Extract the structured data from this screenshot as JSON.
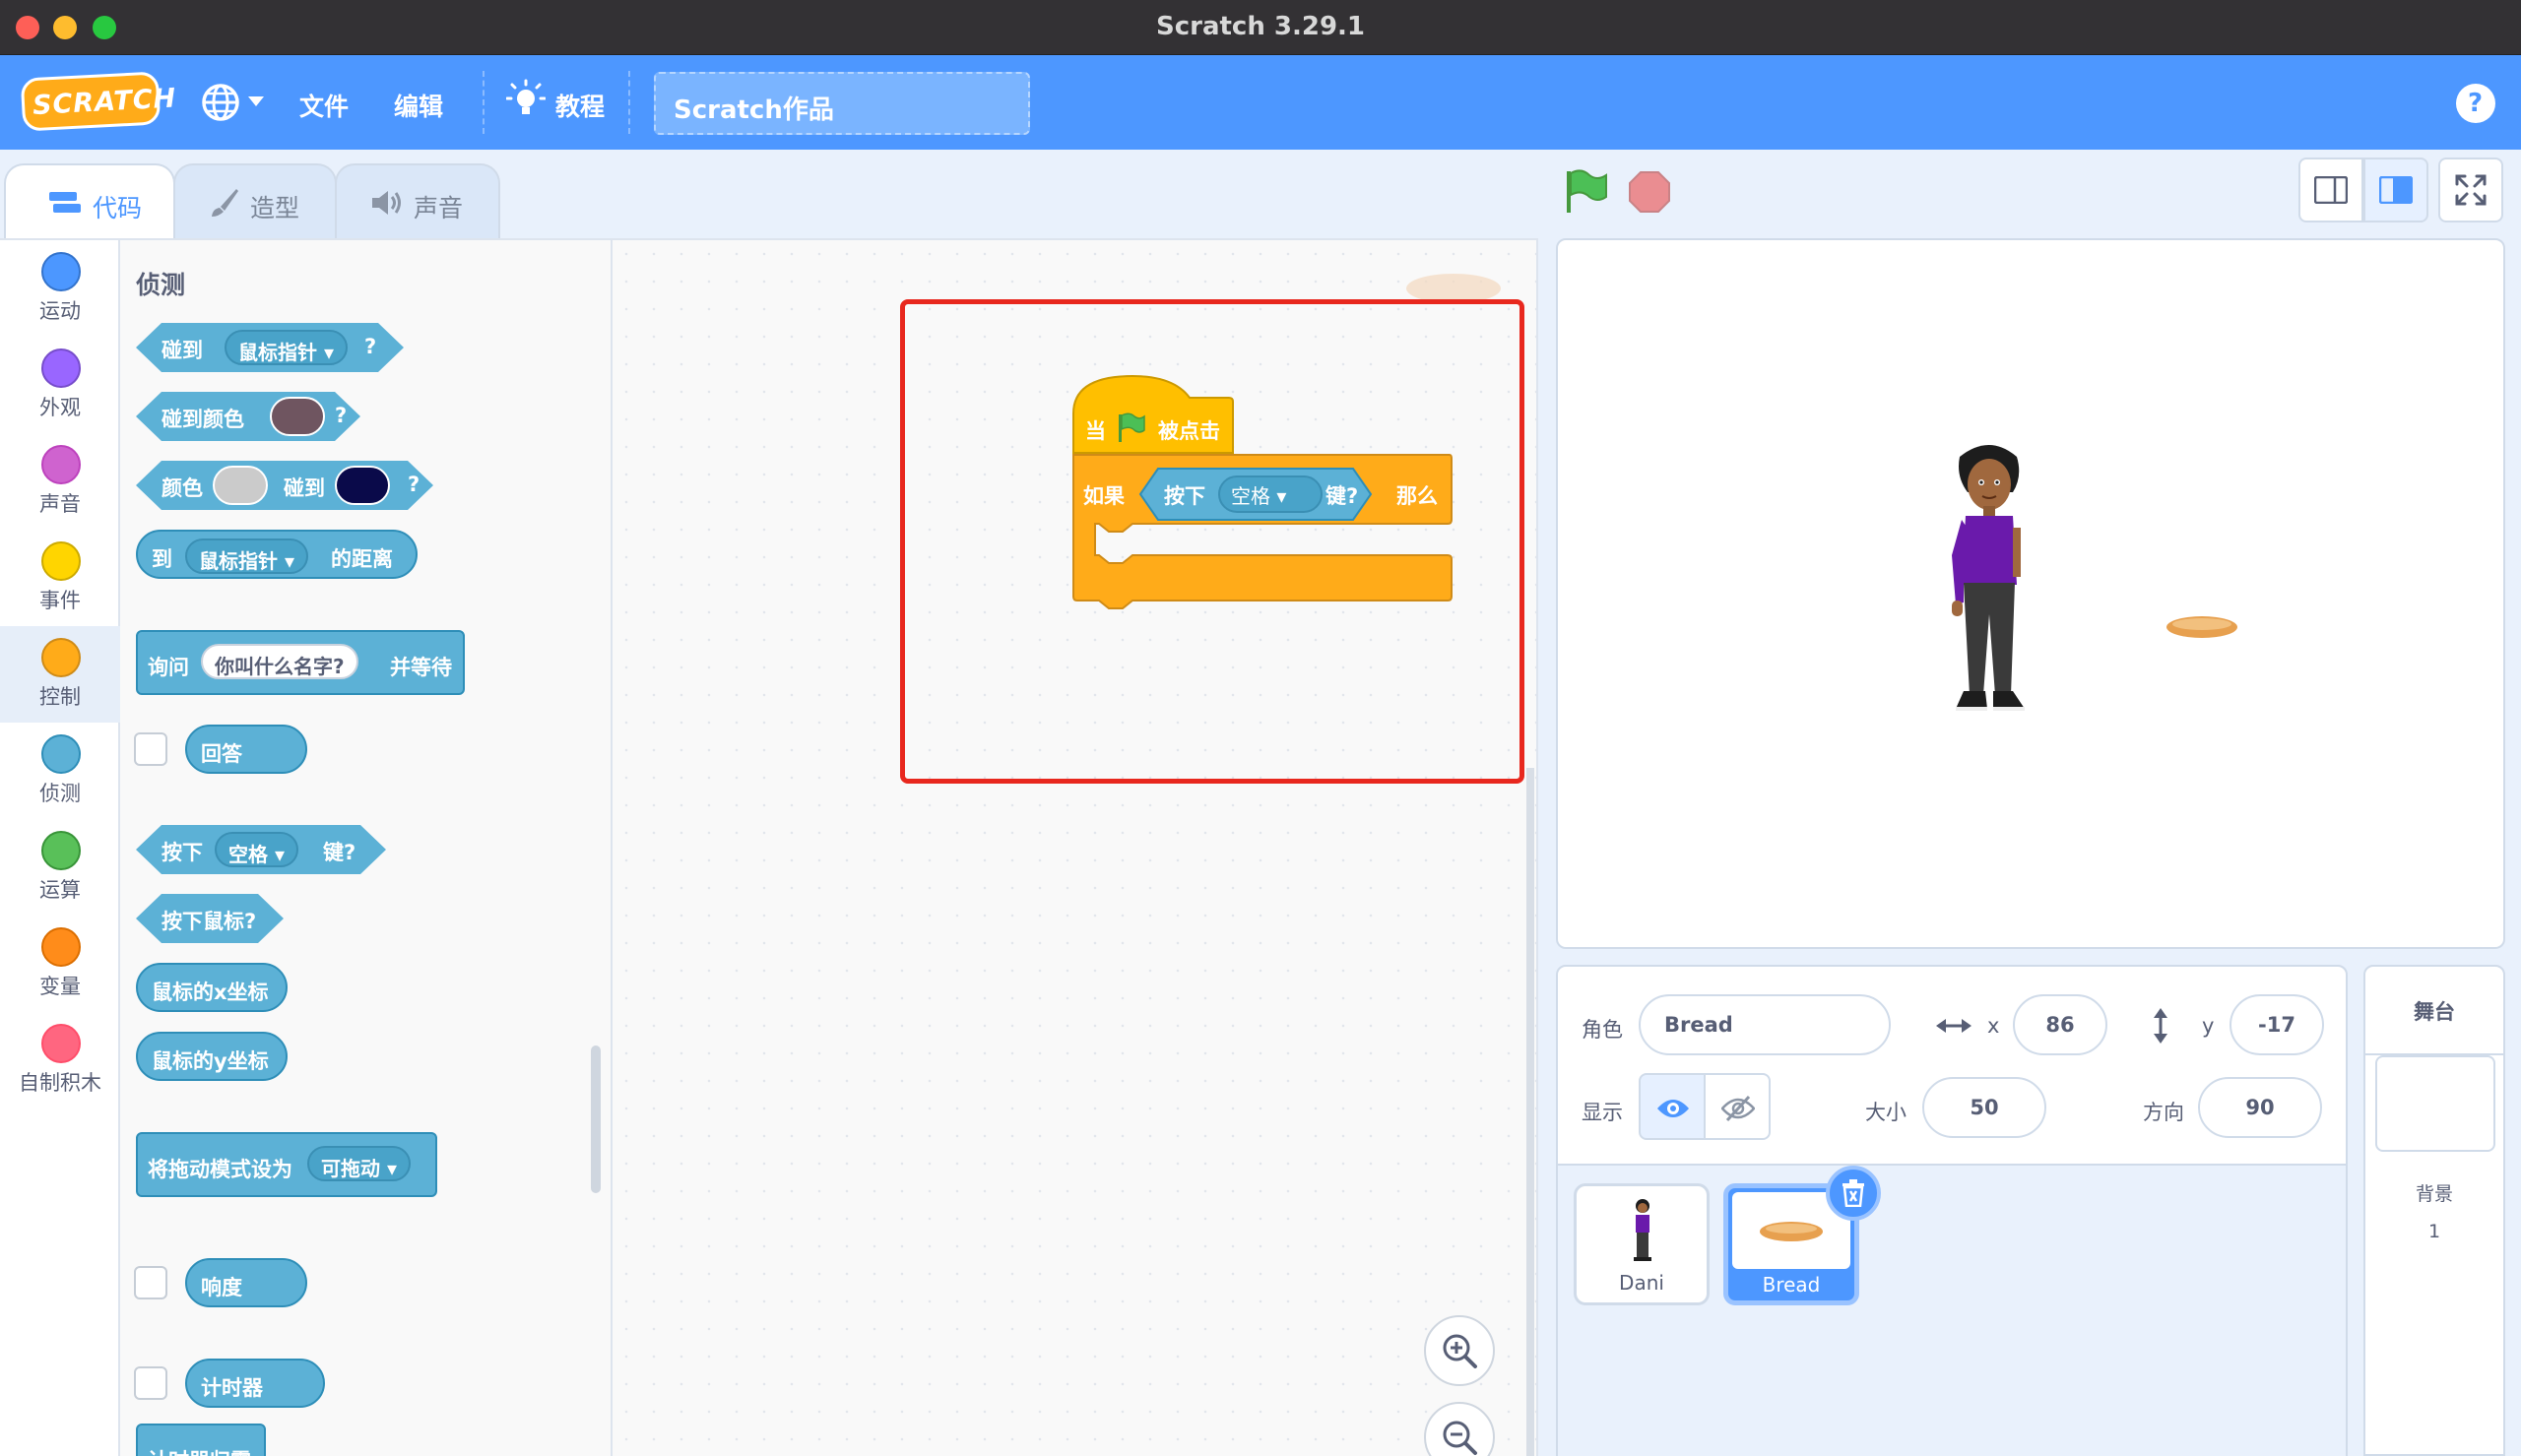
{
  "window": {
    "title": "Scratch 3.29.1"
  },
  "menubar": {
    "logo": "SCRATCH",
    "file": "文件",
    "edit": "编辑",
    "tutorials": "教程",
    "project_title": "Scratch作品",
    "help": "?"
  },
  "tabs": {
    "code": "代码",
    "costumes": "造型",
    "sounds": "声音"
  },
  "categories": [
    {
      "label": "运动",
      "color": "#4c97ff"
    },
    {
      "label": "外观",
      "color": "#9966ff"
    },
    {
      "label": "声音",
      "color": "#cf63cf"
    },
    {
      "label": "事件",
      "color": "#ffd500"
    },
    {
      "label": "控制",
      "color": "#ffab19"
    },
    {
      "label": "侦测",
      "color": "#5cb1d6"
    },
    {
      "label": "运算",
      "color": "#59c059"
    },
    {
      "label": "变量",
      "color": "#ff8c1a"
    },
    {
      "label": "自制积木",
      "color": "#ff6680"
    }
  ],
  "palette": {
    "title": "侦测",
    "touching": {
      "label": "碰到",
      "menu": "鼠标指针",
      "q": "?"
    },
    "touching_color": {
      "label": "碰到颜色",
      "q": "?",
      "swatch": "#6f5560"
    },
    "color_touching": {
      "label1": "颜色",
      "label2": "碰到",
      "q": "?",
      "swatch1": "#cbcbcb",
      "swatch2": "#0a0a4a"
    },
    "distance": {
      "label1": "到",
      "menu": "鼠标指针",
      "label2": "的距离"
    },
    "ask": {
      "label1": "询问",
      "input": "你叫什么名字?",
      "label2": "并等待"
    },
    "answer": "回答",
    "key_pressed": {
      "label1": "按下",
      "menu": "空格",
      "label2": "键?"
    },
    "mouse_down": "按下鼠标?",
    "mouse_x": "鼠标的x坐标",
    "mouse_y": "鼠标的y坐标",
    "drag_mode": {
      "label": "将拖动模式设为",
      "menu": "可拖动"
    },
    "loudness": "响度",
    "timer": "计时器",
    "reset_timer": "计时器归零"
  },
  "script": {
    "hat": {
      "label1": "当",
      "label2": "被点击"
    },
    "if_block": {
      "label1": "如果",
      "key_label1": "按下",
      "key_menu": "空格",
      "key_label2": "键?",
      "label2": "那么"
    }
  },
  "sprite_info": {
    "sprite_label": "角色",
    "sprite_name": "Bread",
    "x_label": "x",
    "x_value": "86",
    "y_label": "y",
    "y_value": "-17",
    "show_label": "显示",
    "size_label": "大小",
    "size_value": "50",
    "direction_label": "方向",
    "direction_value": "90"
  },
  "sprites": [
    {
      "name": "Dani"
    },
    {
      "name": "Bread"
    }
  ],
  "stage_panel": {
    "title": "舞台",
    "backdrops_label": "背景",
    "backdrops_count": "1"
  }
}
